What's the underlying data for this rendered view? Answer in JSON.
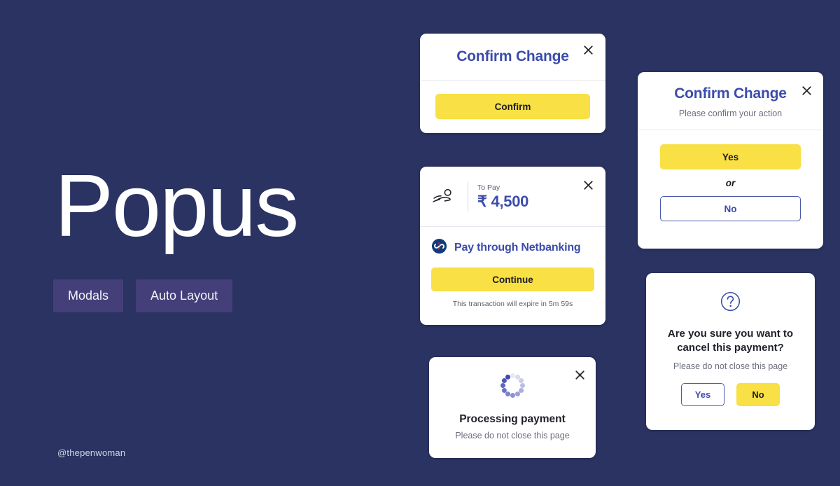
{
  "page": {
    "background_color": "#2a3361",
    "accent_yellow": "#f8e045",
    "accent_blue": "#3c4cab",
    "tag_color": "#443e79"
  },
  "hero": {
    "title": "Popus",
    "tags": [
      {
        "label": "Modals"
      },
      {
        "label": "Auto Layout"
      }
    ],
    "watermark": "@thepenwoman"
  },
  "modals": {
    "confirm_simple": {
      "name": "confirm-change-simple",
      "title": "Confirm Change",
      "close_icon": "close-icon",
      "primary_button": "Confirm"
    },
    "payment": {
      "name": "payment-netbanking",
      "icon": "hand-holding-coin-icon",
      "pay_label": "To Pay",
      "pay_amount": "₹ 4,500",
      "close_icon": "close-icon",
      "bank_icon": "netbanking-bank-logo-icon",
      "bank_method": "Pay through Netbanking",
      "primary_button": "Continue",
      "expiry_note": "This transaction will expire in 5m 59s"
    },
    "processing": {
      "name": "processing-payment",
      "spinner_icon": "loading-spinner-icon",
      "close_icon": "close-icon",
      "title": "Processing payment",
      "subtitle": "Please do not close this page"
    },
    "confirm_yesno": {
      "name": "confirm-change-yes-no",
      "title": "Confirm Change",
      "subtitle": "Please confirm your action",
      "close_icon": "close-icon",
      "yes_button": "Yes",
      "or_label": "or",
      "no_button": "No"
    },
    "cancel_payment": {
      "name": "cancel-payment-confirm",
      "icon": "question-mark-circle-icon",
      "title": "Are you sure you want to cancel this payment?",
      "subtitle": "Please do not close this page",
      "yes_button": "Yes",
      "no_button": "No"
    }
  }
}
